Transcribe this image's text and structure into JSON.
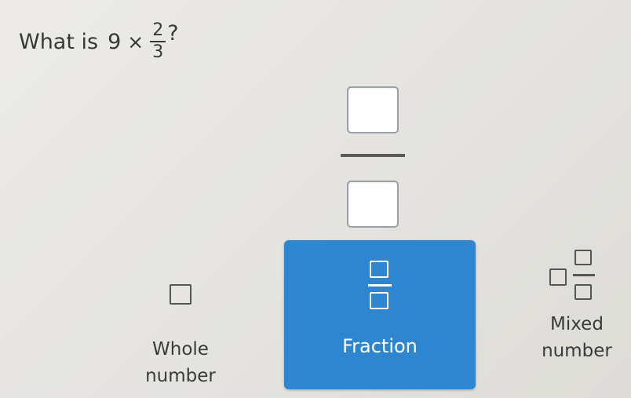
{
  "question": {
    "prefix": "What is",
    "whole": "9",
    "operator": "×",
    "fraction_numerator": "2",
    "fraction_denominator": "3",
    "suffix": "?"
  },
  "answer_input": {
    "numerator_value": "",
    "denominator_value": ""
  },
  "format_options": {
    "whole_number": "Whole\nnumber",
    "fraction": "Fraction",
    "mixed_number": "Mixed\nnumber",
    "selected": "fraction"
  },
  "colors": {
    "selected_option": "#2e86d0"
  },
  "icons": {
    "whole": "whole-number-box-icon",
    "fraction": "fraction-icon",
    "mixed": "mixed-number-icon"
  }
}
